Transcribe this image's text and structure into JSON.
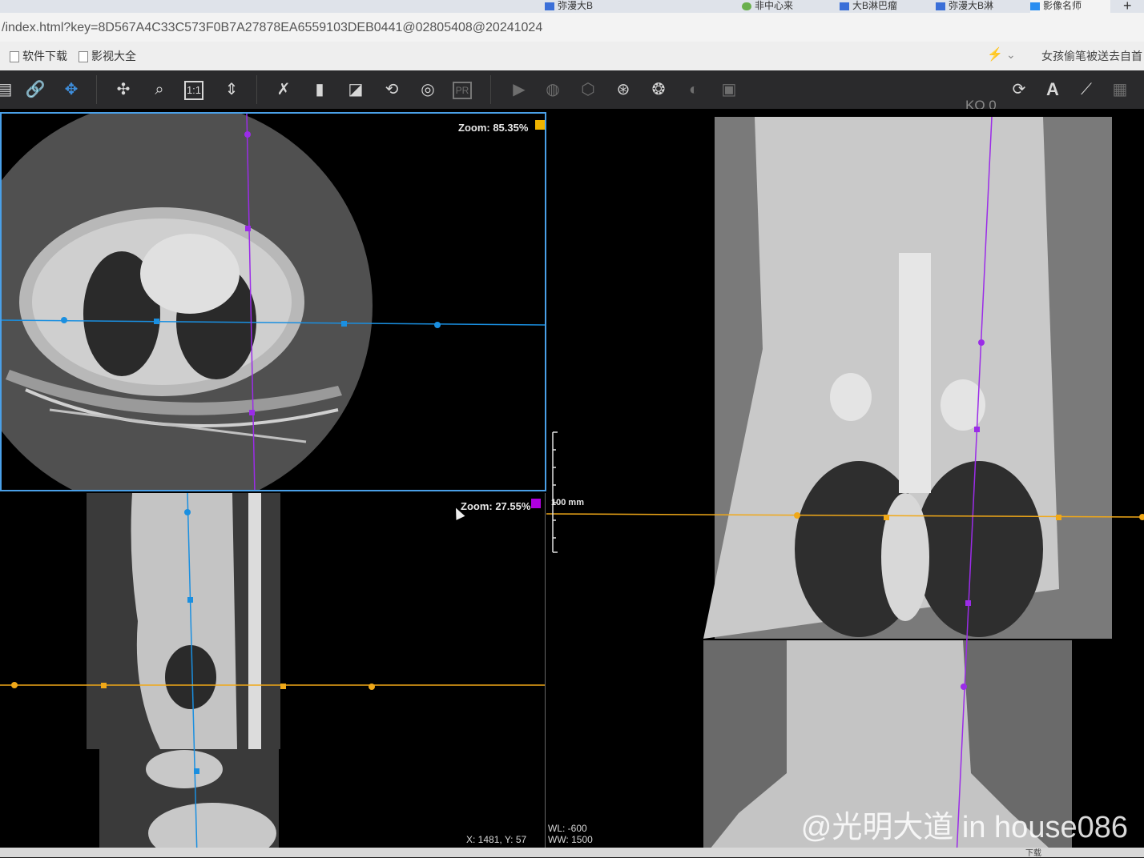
{
  "browser": {
    "tabs": [
      {
        "label": "弥漫大B",
        "icon": "paw-icon"
      },
      {
        "label": "非中心来",
        "icon": "circle-icon"
      },
      {
        "label": "大B淋巴瘤",
        "icon": "paw-icon"
      },
      {
        "label": "弥漫大B淋",
        "icon": "paw-icon"
      },
      {
        "label": "影像名师",
        "icon": "tv-icon"
      }
    ],
    "new_tab": "+",
    "url": "/index.html?key=8D567A4C33C573F0B7A27878EA6559103DEB0441@02805408@20241024",
    "bookmarks": [
      "软件下载",
      "影视大全"
    ],
    "news_text": "女孩偷笔被送去自首"
  },
  "toolbar": {
    "ko_label": "KO 0",
    "text_tool": "A",
    "pr_label": "PR"
  },
  "viewports": {
    "axial": {
      "zoom": "Zoom: 85.35%",
      "color": "#f0b400"
    },
    "sagittal": {
      "zoom": "Zoom: 27.55%",
      "color": "#b000e0",
      "coords": "X: 1481, Y: 57"
    },
    "coronal": {
      "scale": "100 mm",
      "wl": "WL: -600",
      "ww": "WW: 1500"
    }
  },
  "colors": {
    "blue": "#1a8fe0",
    "purple": "#9b2ce8",
    "orange": "#f0a818",
    "border": "#4aa0e8"
  },
  "watermark": "@光明大道 in house086",
  "taskbar": {
    "download": "下载"
  }
}
